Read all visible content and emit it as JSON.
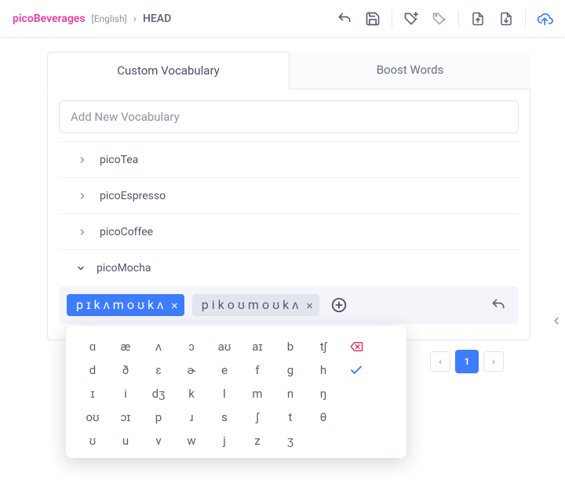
{
  "breadcrumb": {
    "brand": "picoBeverages",
    "language": "[English]",
    "sep": "›",
    "head": "HEAD"
  },
  "tabs": {
    "custom": "Custom Vocabulary",
    "boost": "Boost Words"
  },
  "addPlaceholder": "Add New Vocabulary",
  "vocab": {
    "items": [
      "picoTea",
      "picoEspresso",
      "picoCoffee"
    ],
    "expanded": "picoMocha"
  },
  "chips": {
    "active": "pɪkʌmoʊkʌ",
    "alt": "pikoʊmoʊkʌ",
    "x": "×"
  },
  "ipa": {
    "rows": [
      [
        "ɑ",
        "æ",
        "ʌ",
        "ɔ",
        "aʊ",
        "aɪ",
        "b",
        "tʃ"
      ],
      [
        "d",
        "ð",
        "ɛ",
        "ɚ",
        "e",
        "f",
        "g",
        "h"
      ],
      [
        "ɪ",
        "i",
        "dʒ",
        "k",
        "l",
        "m",
        "n",
        "ŋ"
      ],
      [
        "oʊ",
        "ɔɪ",
        "p",
        "ɹ",
        "s",
        "ʃ",
        "t",
        "θ"
      ],
      [
        "ʊ",
        "u",
        "v",
        "w",
        "j",
        "z",
        "ʒ",
        ""
      ]
    ]
  },
  "pager": {
    "num": "1",
    "left": "‹",
    "right": "›"
  }
}
